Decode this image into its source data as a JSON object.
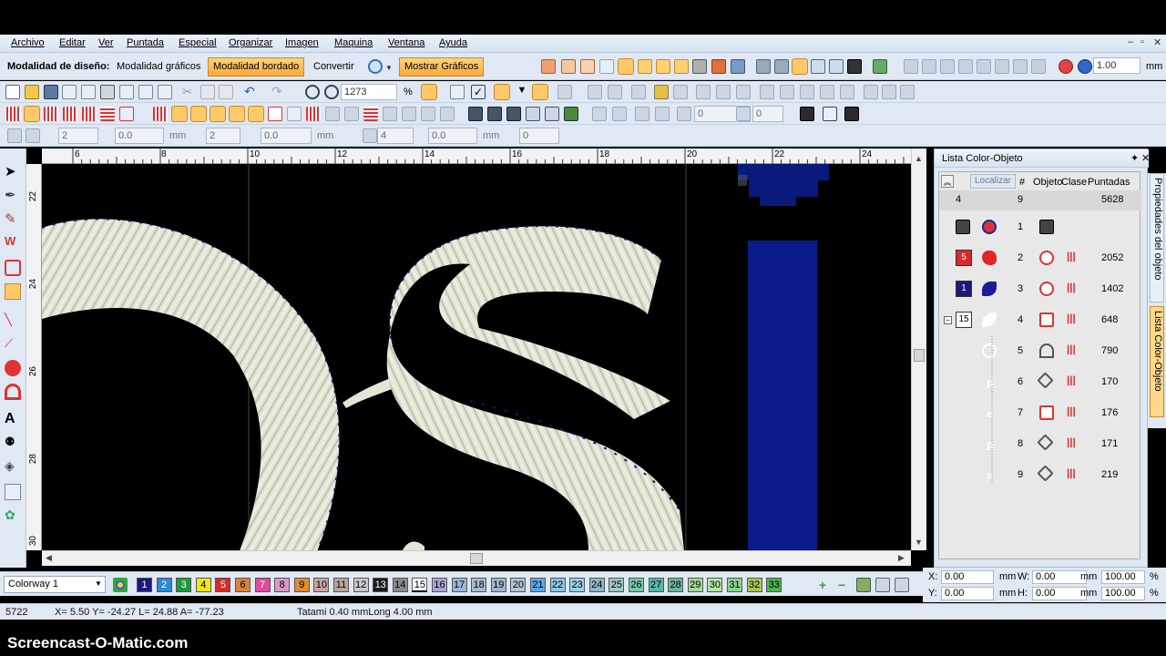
{
  "menu": [
    "Archivo",
    "Editar",
    "Ver",
    "Puntada",
    "Especial",
    "Organizar",
    "Imagen",
    "Maquina",
    "Ventana",
    "Ayuda"
  ],
  "mode": {
    "label": "Modalidad de diseño:",
    "graficos": "Modalidad gráficos",
    "bordado": "Modalidad bordado",
    "convertir": "Convertir",
    "mostrar": "Mostrar Gráficos",
    "scale_value": "1.00",
    "scale_unit": "mm"
  },
  "toolbar": {
    "zoom_value": "1273",
    "zoom_unit": "%",
    "angle1": "0",
    "angle2": "0",
    "f1": "2",
    "f2": "0.0",
    "f3": "mm",
    "f4": "2",
    "f5": "0.0",
    "f6": "mm",
    "f7": "4",
    "f8": "0.0",
    "f9": "mm",
    "f10": "0"
  },
  "ruler": {
    "top": [
      "6",
      "8",
      "10",
      "12",
      "14",
      "16",
      "18",
      "20",
      "22",
      "24"
    ],
    "left": [
      "22",
      "24",
      "26",
      "28",
      "30"
    ]
  },
  "panel": {
    "title": "Lista Color-Objeto",
    "localizar": "Localizar",
    "col_hash": "#",
    "col_objeto": "Objeto",
    "col_clase": "Clase",
    "col_puntadas": "Puntadas",
    "summary": {
      "count": "4",
      "num": "9",
      "stitches": "5628"
    },
    "rows": [
      {
        "num": "1",
        "stitches": "",
        "chip": ""
      },
      {
        "num": "2",
        "stitches": "2052",
        "chip": "5"
      },
      {
        "num": "3",
        "stitches": "1402",
        "chip": "1"
      },
      {
        "num": "4",
        "stitches": "648",
        "chip": "15"
      },
      {
        "num": "5",
        "stitches": "790",
        "chip": ""
      },
      {
        "num": "6",
        "stitches": "170",
        "chip": ""
      },
      {
        "num": "7",
        "stitches": "176",
        "chip": ""
      },
      {
        "num": "8",
        "stitches": "171",
        "chip": ""
      },
      {
        "num": "9",
        "stitches": "219",
        "chip": ""
      }
    ],
    "side_tab_1": "Propiedades del objeto",
    "side_tab_2": "Lista Color-Objeto"
  },
  "colorbar": {
    "colorway": "Colorway 1",
    "swatches": [
      {
        "n": "1",
        "bg": "#1a1a7a",
        "fg": "#ffffff"
      },
      {
        "n": "2",
        "bg": "#2a8ad6",
        "fg": "#ffffff"
      },
      {
        "n": "3",
        "bg": "#1f9a3a",
        "fg": "#ffffff"
      },
      {
        "n": "4",
        "bg": "#f3e60f",
        "fg": "#000000"
      },
      {
        "n": "5",
        "bg": "#d42a2a",
        "fg": "#ffffff"
      },
      {
        "n": "6",
        "bg": "#d9823a",
        "fg": "#000000"
      },
      {
        "n": "7",
        "bg": "#e04a9a",
        "fg": "#ffffff"
      },
      {
        "n": "8",
        "bg": "#d79ac6",
        "fg": "#000000"
      },
      {
        "n": "9",
        "bg": "#e28a2a",
        "fg": "#000000"
      },
      {
        "n": "10",
        "bg": "#c9a4a4",
        "fg": "#000000"
      },
      {
        "n": "11",
        "bg": "#b7a79a",
        "fg": "#000000"
      },
      {
        "n": "12",
        "bg": "#c9c9c9",
        "fg": "#000000"
      },
      {
        "n": "13",
        "bg": "#1a1a1a",
        "fg": "#ffffff"
      },
      {
        "n": "14",
        "bg": "#8a8a8a",
        "fg": "#000000"
      },
      {
        "n": "15",
        "bg": "#ffffff",
        "fg": "#000000"
      },
      {
        "n": "16",
        "bg": "#a6a6d6",
        "fg": "#000000"
      },
      {
        "n": "17",
        "bg": "#9ab6d6",
        "fg": "#000000"
      },
      {
        "n": "18",
        "bg": "#a9b9cf",
        "fg": "#000000"
      },
      {
        "n": "19",
        "bg": "#9fb4cf",
        "fg": "#000000"
      },
      {
        "n": "20",
        "bg": "#b3c2d3",
        "fg": "#000000"
      },
      {
        "n": "21",
        "bg": "#5aa6e6",
        "fg": "#000000"
      },
      {
        "n": "22",
        "bg": "#8ac6e6",
        "fg": "#000000"
      },
      {
        "n": "23",
        "bg": "#9ad0e6",
        "fg": "#000000"
      },
      {
        "n": "24",
        "bg": "#8fb7c7",
        "fg": "#000000"
      },
      {
        "n": "25",
        "bg": "#9fc7c7",
        "fg": "#000000"
      },
      {
        "n": "26",
        "bg": "#7ac7a6",
        "fg": "#000000"
      },
      {
        "n": "27",
        "bg": "#5ab6a6",
        "fg": "#000000"
      },
      {
        "n": "28",
        "bg": "#6ab69a",
        "fg": "#000000"
      },
      {
        "n": "29",
        "bg": "#a6d69a",
        "fg": "#000000"
      },
      {
        "n": "30",
        "bg": "#b6e6a6",
        "fg": "#000000"
      },
      {
        "n": "31",
        "bg": "#8ad68a",
        "fg": "#000000"
      },
      {
        "n": "32",
        "bg": "#a6c65a",
        "fg": "#000000"
      },
      {
        "n": "33",
        "bg": "#4ab64a",
        "fg": "#000000"
      }
    ]
  },
  "coords": {
    "x_label": "X:",
    "x_val": "0.00",
    "x_unit": "mm",
    "y_label": "Y:",
    "y_val": "0.00",
    "y_unit": "mm",
    "w_label": "W:",
    "w_val": "0.00",
    "w_unit": "mm",
    "w_pct": "100.00",
    "w_pct_unit": "%",
    "h_label": "H:",
    "h_val": "0.00",
    "h_unit": "mm",
    "h_pct": "100.00",
    "h_pct_unit": "%"
  },
  "status": {
    "count": "5722",
    "coords": "X=  5.50 Y= -24.27 L=  24.88 A= -77.23",
    "stitch": "Tatami 0.40 mmLong 4.00 mm"
  },
  "watermark": "Screencast-O-Matic.com",
  "colors": {
    "accent": "#f7a83a",
    "chrome": "#dfe8f3",
    "thread_white": "#e8eadf",
    "thread_navy": "#0a1a8a"
  }
}
